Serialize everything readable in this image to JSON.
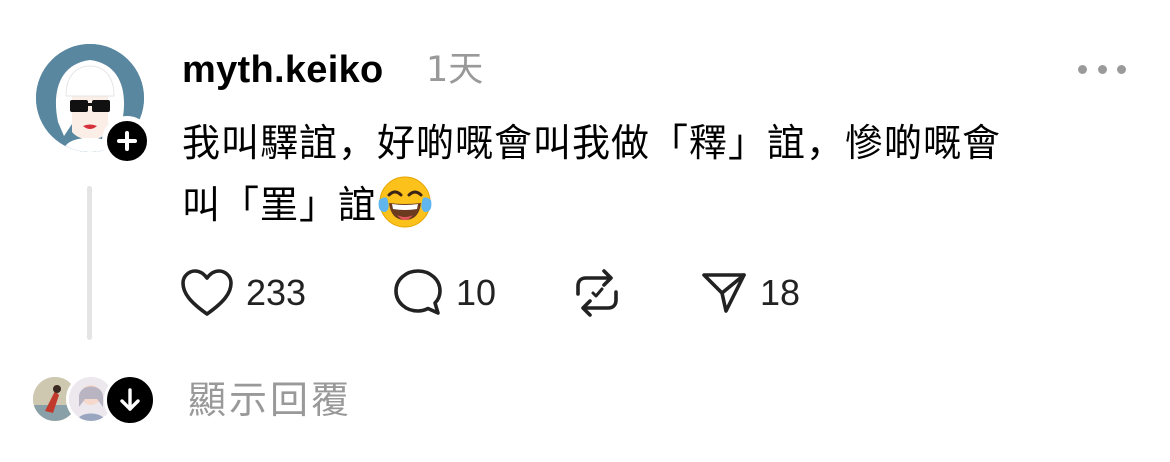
{
  "post": {
    "username": "myth.keiko",
    "timestamp": "1天",
    "text_line1": "我叫驛誼，好啲嘅會叫我做「釋」誼，慘啲嘅會",
    "text_line2": "叫「罣」誼",
    "emoji": "face-with-tears-of-joy"
  },
  "actions": {
    "like_count": "233",
    "comment_count": "10",
    "repost_count": "",
    "share_count": "18"
  },
  "replies": {
    "show_label": "顯示回覆"
  },
  "colors": {
    "avatar_bg": "#5a87a0",
    "muted_text": "#999999",
    "thread_line": "#e4e4e4"
  }
}
